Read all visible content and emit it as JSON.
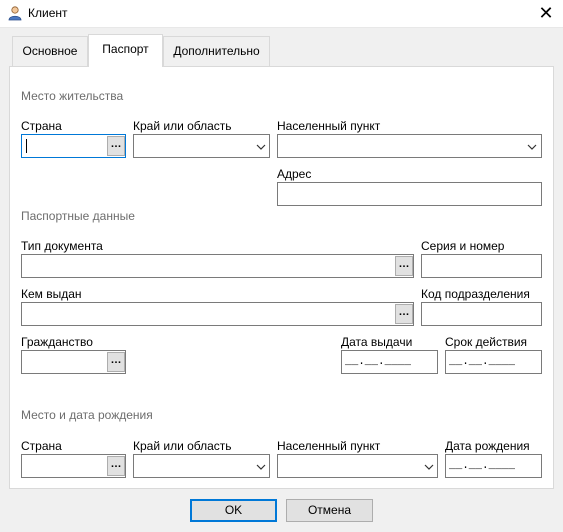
{
  "window": {
    "title": "Клиент"
  },
  "tabs": [
    {
      "label": "Основное"
    },
    {
      "label": "Паспорт"
    },
    {
      "label": "Дополнительно"
    }
  ],
  "residence": {
    "heading": "Место жительства",
    "country_label": "Страна",
    "region_label": "Край или область",
    "locality_label": "Населенный пункт",
    "address_label": "Адрес"
  },
  "passport": {
    "heading": "Паспортные данные",
    "doc_type_label": "Тип документа",
    "series_label": "Серия и номер",
    "issued_by_label": "Кем выдан",
    "dept_code_label": "Код подразделения",
    "citizenship_label": "Гражданство",
    "issue_date_label": "Дата выдачи",
    "expiry_label": "Срок действия",
    "issue_date_value": "__.__.____",
    "expiry_value": "__.__.____"
  },
  "birth": {
    "heading": "Место и дата рождения",
    "country_label": "Страна",
    "region_label": "Край или область",
    "locality_label": "Населенный пункт",
    "date_label": "Дата рождения",
    "date_value": "__.__.____"
  },
  "common": {
    "ellipsis": "…"
  },
  "buttons": {
    "ok": "OK",
    "cancel": "Отмена"
  }
}
